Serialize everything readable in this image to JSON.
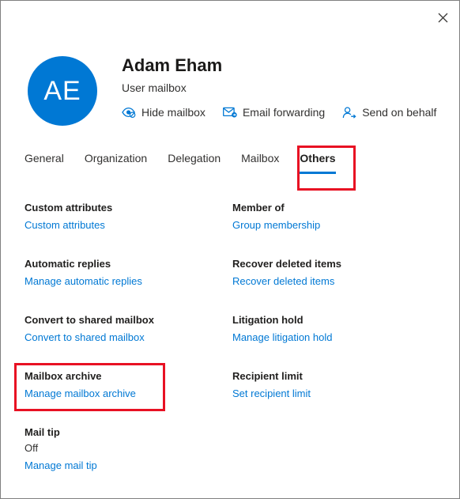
{
  "window": {
    "close_icon": "close-icon",
    "border_color": "#808080"
  },
  "header": {
    "avatar_initials": "AE",
    "avatar_color": "#0078d4",
    "display_name": "Adam Eham",
    "mailbox_type": "User mailbox",
    "quick_actions": [
      {
        "label": "Hide mailbox",
        "icon": "hide-eye-icon"
      },
      {
        "label": "Email forwarding",
        "icon": "envelope-forward-icon"
      },
      {
        "label": "Send on behalf",
        "icon": "person-arrow-icon"
      }
    ]
  },
  "tabs": {
    "accent_color": "#0078d4",
    "items": [
      {
        "label": "General",
        "active": false
      },
      {
        "label": "Organization",
        "active": false
      },
      {
        "label": "Delegation",
        "active": false
      },
      {
        "label": "Mailbox",
        "active": false
      },
      {
        "label": "Others",
        "active": true
      }
    ]
  },
  "annotations": {
    "color": "#e81123",
    "boxes": [
      {
        "target": "others-tab"
      },
      {
        "target": "mailbox-archive-setting"
      }
    ]
  },
  "settings": {
    "left_column": [
      {
        "title": "Custom attributes",
        "value": null,
        "link": "Custom attributes"
      },
      {
        "title": "Automatic replies",
        "value": null,
        "link": "Manage automatic replies"
      },
      {
        "title": "Convert to shared mailbox",
        "value": null,
        "link": "Convert to shared mailbox"
      },
      {
        "title": "Mailbox archive",
        "value": null,
        "link": "Manage mailbox archive"
      },
      {
        "title": "Mail tip",
        "value": "Off",
        "link": "Manage mail tip"
      }
    ],
    "right_column": [
      {
        "title": "Member of",
        "value": null,
        "link": "Group membership"
      },
      {
        "title": "Recover deleted items",
        "value": null,
        "link": "Recover deleted items"
      },
      {
        "title": "Litigation hold",
        "value": null,
        "link": "Manage litigation hold"
      },
      {
        "title": "Recipient limit",
        "value": null,
        "link": "Set recipient limit"
      }
    ]
  }
}
